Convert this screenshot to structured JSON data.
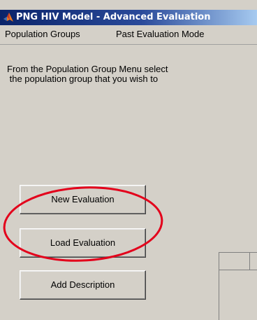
{
  "window": {
    "title": "PNG HIV Model - Advanced Evaluation",
    "icon": "matlab-logo-icon"
  },
  "menu": {
    "items": [
      {
        "label": "Population Groups"
      },
      {
        "label": "Past Evaluation Mode"
      }
    ]
  },
  "instruction": {
    "line1": "From the Population Group Menu select",
    "line2": " the population group that you wish to"
  },
  "buttons": {
    "new_evaluation": "New Evaluation",
    "load_evaluation": "Load Evaluation",
    "add_description": "Add Description"
  },
  "annotation": {
    "color": "#e3001b",
    "shape": "ellipse"
  }
}
